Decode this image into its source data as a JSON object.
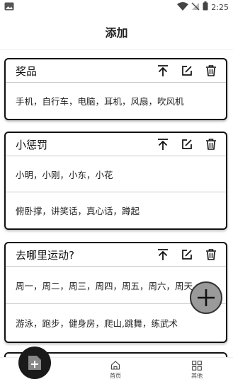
{
  "status_bar": {
    "time": "2:25"
  },
  "header": {
    "title": "添加"
  },
  "cards": [
    {
      "title": "奖品",
      "rows": [
        "手机，自行车，电脑，耳机，风扇，吹风机"
      ]
    },
    {
      "title": "小惩罚",
      "rows": [
        "小明，小刚，小东，小花",
        "俯卧撑，讲笑话，真心话，蹲起"
      ]
    },
    {
      "title": "去哪里运动?",
      "rows": [
        "周一，周二，周三，周四，周五，周六，周天",
        "游泳，跑步，健身房，爬山,跳舞，练武术"
      ]
    }
  ],
  "bottom_nav": {
    "home_label": "首页",
    "other_label": "其他"
  },
  "colors": {
    "fab_right": "#9a9a9a",
    "fab_left": "#1a1a1a",
    "card_border": "#111111"
  }
}
